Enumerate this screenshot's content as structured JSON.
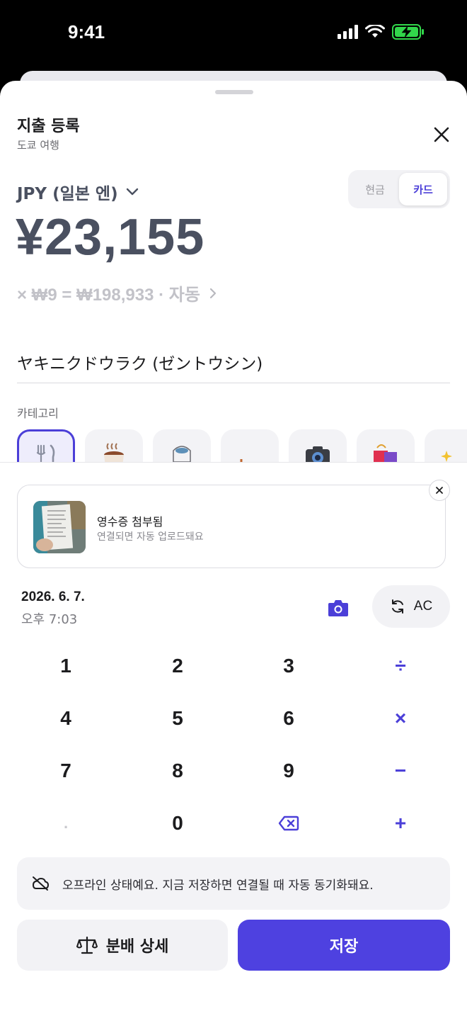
{
  "status_bar": {
    "time": "9:41"
  },
  "header": {
    "title": "지출 등록",
    "subtitle": "도쿄 여행"
  },
  "currency": {
    "label": "JPY (일본 엔)"
  },
  "payment_method": {
    "options": [
      "현금",
      "카드"
    ],
    "selected": "카드"
  },
  "amount": {
    "display": "¥23,155"
  },
  "conversion": {
    "text": "× ₩9 = ₩198,933 · 자동"
  },
  "memo": {
    "value": "ヤキニクドウラク (ゼントウシン)"
  },
  "category": {
    "label": "카테고리",
    "icons": [
      "fork-knife-icon",
      "coffee-icon",
      "train-icon",
      "plant-icon",
      "camera-icon",
      "shopping-bag-icon",
      "sparkle-icon"
    ]
  },
  "receipt": {
    "title": "영수증 첨부됨",
    "subtitle": "연결되면 자동 업로드돼요"
  },
  "datetime": {
    "date": "2026. 6. 7.",
    "time": "오후 7:03"
  },
  "ac_button": {
    "label": "AC"
  },
  "keypad": {
    "keys": [
      "1",
      "2",
      "3",
      "÷",
      "4",
      "5",
      "6",
      "×",
      "7",
      "8",
      "9",
      "−",
      ".",
      "0",
      "",
      "+"
    ]
  },
  "offline_notice": {
    "text": "오프라인 상태예요. 지금 저장하면 연결될 때 자동 동기화돼요."
  },
  "actions": {
    "split_label": "분배 상세",
    "save_label": "저장"
  },
  "colors": {
    "accent": "#4e41e0",
    "amount": "#4a5060"
  }
}
